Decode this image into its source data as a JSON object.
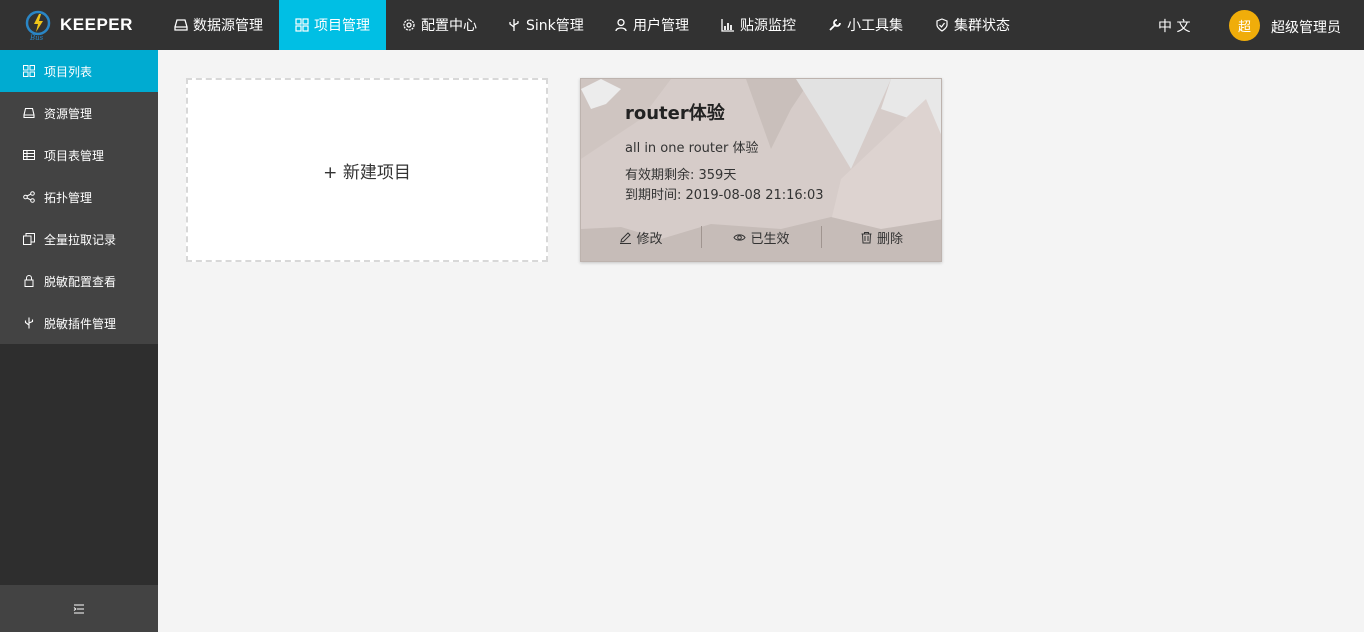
{
  "header": {
    "logo_text": "KEEPER",
    "nav": [
      {
        "label": "数据源管理",
        "icon": "drive-icon"
      },
      {
        "label": "项目管理",
        "icon": "grid-icon",
        "active": true
      },
      {
        "label": "配置中心",
        "icon": "gear-icon"
      },
      {
        "label": "Sink管理",
        "icon": "usb-icon"
      },
      {
        "label": "用户管理",
        "icon": "user-icon"
      },
      {
        "label": "贴源监控",
        "icon": "chart-icon"
      },
      {
        "label": "小工具集",
        "icon": "wrench-icon"
      },
      {
        "label": "集群状态",
        "icon": "shield-icon"
      }
    ],
    "language": "中 文",
    "avatar_text": "超",
    "username": "超级管理员"
  },
  "sidebar": {
    "items": [
      {
        "label": "项目列表",
        "icon": "grid-icon",
        "active": true
      },
      {
        "label": "资源管理",
        "icon": "drive-icon"
      },
      {
        "label": "项目表管理",
        "icon": "table-icon"
      },
      {
        "label": "拓扑管理",
        "icon": "share-icon"
      },
      {
        "label": "全量拉取记录",
        "icon": "copy-icon"
      },
      {
        "label": "脱敏配置查看",
        "icon": "lock-icon"
      },
      {
        "label": "脱敏插件管理",
        "icon": "usb-icon"
      }
    ],
    "collapse_icon": "menu-fold-icon"
  },
  "content": {
    "new_project_label": "+ 新建项目",
    "project": {
      "title": "router体验",
      "description": "all in one router 体验",
      "remaining": "有效期剩余: 359天",
      "expire": "到期时间: 2019-08-08 21:16:03",
      "actions": {
        "edit": "修改",
        "status": "已生效",
        "delete": "删除"
      }
    }
  },
  "colors": {
    "header_bg": "#323232",
    "accent": "#00bfe4",
    "sidebar_active": "#00abd1",
    "avatar": "#f0ad0a"
  }
}
